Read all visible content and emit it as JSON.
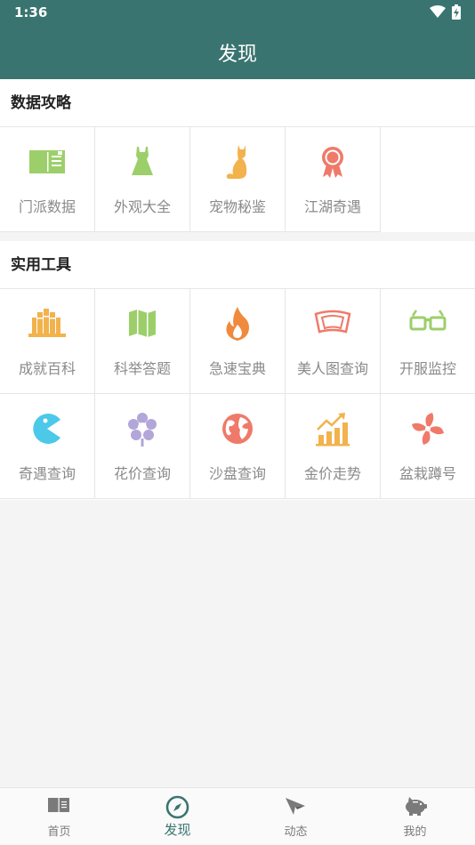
{
  "status": {
    "time": "1:36"
  },
  "header": {
    "title": "发现"
  },
  "sections": [
    {
      "title": "数据攻略",
      "items": [
        {
          "label": "门派数据",
          "icon": "id-card-icon"
        },
        {
          "label": "外观大全",
          "icon": "dress-icon"
        },
        {
          "label": "宠物秘鉴",
          "icon": "cat-icon"
        },
        {
          "label": "江湖奇遇",
          "icon": "ribbon-badge-icon"
        }
      ]
    },
    {
      "title": "实用工具",
      "items": [
        {
          "label": "成就百科",
          "icon": "books-icon"
        },
        {
          "label": "科举答题",
          "icon": "map-icon"
        },
        {
          "label": "急速宝典",
          "icon": "fire-icon"
        },
        {
          "label": "美人图查询",
          "icon": "frame-icon"
        },
        {
          "label": "开服监控",
          "icon": "glasses-icon"
        },
        {
          "label": "奇遇查询",
          "icon": "pacman-icon"
        },
        {
          "label": "花价查询",
          "icon": "flower-icon"
        },
        {
          "label": "沙盘查询",
          "icon": "globe-icon"
        },
        {
          "label": "金价走势",
          "icon": "chart-up-icon"
        },
        {
          "label": "盆栽蹲号",
          "icon": "pinwheel-icon"
        }
      ]
    }
  ],
  "tabs": [
    {
      "label": "首页",
      "icon": "book-icon"
    },
    {
      "label": "发现",
      "icon": "compass-icon",
      "active": true
    },
    {
      "label": "动态",
      "icon": "paper-plane-icon"
    },
    {
      "label": "我的",
      "icon": "piggy-bank-icon"
    }
  ],
  "colors": {
    "primary": "#3a7470",
    "green": "#9ccf6a",
    "orange": "#f2b24c",
    "red": "#ef7a6a",
    "cyan": "#4cc9e8",
    "purple": "#b3a6d9"
  }
}
